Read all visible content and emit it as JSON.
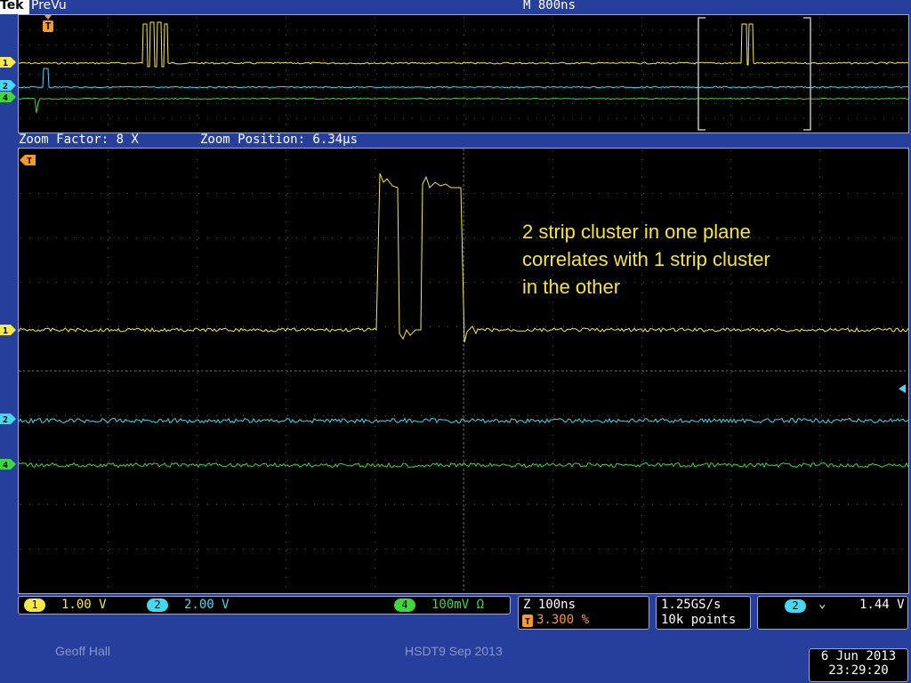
{
  "header": {
    "brand": "Tek",
    "mode": "PreVu",
    "timebase": "M 800ns"
  },
  "zoom": {
    "factor": "Zoom Factor: 8 X",
    "position": "Zoom Position: 6.34µs"
  },
  "channels": [
    {
      "id": "1",
      "color": "#f7e94a"
    },
    {
      "id": "2",
      "color": "#45d9f0"
    },
    {
      "id": "4",
      "color": "#3fd83a"
    }
  ],
  "trigger_marker": "T",
  "annotation": {
    "line1": "2 strip cluster in one plane",
    "line2": "correlates with 1 strip cluster",
    "line3": "in the other"
  },
  "status": {
    "ch1_scale": "1.00 V",
    "ch2_scale": "2.00 V",
    "ch4_scale": "100mV Ω",
    "zoom_time": "Z 100ns",
    "trigger_pos": "3.300 %",
    "sample_rate": "1.25GS/s",
    "record_length": "10k points",
    "trigger_channel": "2",
    "trigger_slope": "⌄",
    "trigger_level": "1.44 V"
  },
  "footer": {
    "author": "Geoff Hall",
    "event": "HSDT9 Sep 2013",
    "date": "6 Jun 2013",
    "time": "23:29:20"
  }
}
